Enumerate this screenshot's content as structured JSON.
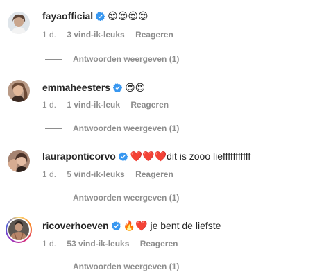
{
  "comments": [
    {
      "username": "fayaofficial",
      "text": "😍😍😍😍",
      "time": "1 d.",
      "likes": "3 vind-ik-leuks",
      "reply": "Reageren",
      "replies_toggle": "Antwoorden weergeven (1)",
      "verified": true
    },
    {
      "username": "emmaheesters",
      "text": "😍😍",
      "time": "1 d.",
      "likes": "1 vind-ik-leuk",
      "reply": "Reageren",
      "replies_toggle": "Antwoorden weergeven (1)",
      "verified": true
    },
    {
      "username": "lauraponticorvo",
      "text": "❤️❤️❤️dit is zooo liefffffffffff",
      "time": "1 d.",
      "likes": "5 vind-ik-leuks",
      "reply": "Reageren",
      "replies_toggle": "Antwoorden weergeven (1)",
      "verified": true
    },
    {
      "username": "ricoverhoeven",
      "text": "🔥❤️ je bent de liefste",
      "time": "1 d.",
      "likes": "53 vind-ik-leuks",
      "reply": "Reageren",
      "replies_toggle": "Antwoorden weergeven (1)",
      "verified": true
    }
  ],
  "colors": {
    "text": "#262626",
    "secondary": "#8e8e8e",
    "verified": "#3897f0"
  }
}
